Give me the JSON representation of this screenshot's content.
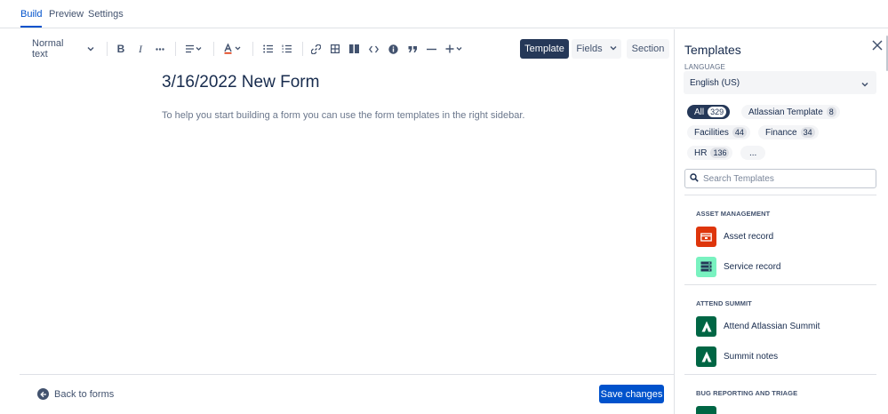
{
  "tabs": [
    {
      "label": "Build",
      "active": true
    },
    {
      "label": "Preview",
      "active": false
    },
    {
      "label": "Settings",
      "active": false
    }
  ],
  "toolbar": {
    "text_style": "Normal text",
    "template": "Template",
    "fields": "Fields",
    "section": "Section",
    "icons": [
      "chevron-down-icon",
      "bold-icon",
      "italic-icon",
      "more-icon",
      "align-icon",
      "text-color-icon",
      "bullet-list-icon",
      "numbered-list-icon",
      "link-icon",
      "table-icon",
      "layout-icon",
      "code-icon",
      "info-icon",
      "quote-icon",
      "divider-icon",
      "plus-icon"
    ]
  },
  "form": {
    "title": "3/16/2022 New Form",
    "hint": "To help you start building a form you can use the form templates in the right sidebar."
  },
  "footer": {
    "back": "Back to forms",
    "save": "Save changes"
  },
  "sidebar": {
    "title": "Templates",
    "language_label": "LANGUAGE",
    "language_value": "English (US)",
    "filters": [
      {
        "label": "All",
        "count": "329",
        "active": true
      },
      {
        "label": "Atlassian Template",
        "count": "8",
        "active": false
      },
      {
        "label": "Facilities",
        "count": "44",
        "active": false
      },
      {
        "label": "Finance",
        "count": "34",
        "active": false
      },
      {
        "label": "HR",
        "count": "136",
        "active": false
      },
      {
        "label": "...",
        "count": "",
        "active": false
      }
    ],
    "search_placeholder": "Search Templates",
    "categories": [
      {
        "title": "ASSET MANAGEMENT",
        "items": [
          {
            "label": "Asset record",
            "icon": "asset-icon",
            "color": "#de350b"
          },
          {
            "label": "Service record",
            "icon": "server-icon",
            "color": "#79f2c0"
          }
        ]
      },
      {
        "title": "ATTEND SUMMIT",
        "items": [
          {
            "label": "Attend Atlassian Summit",
            "icon": "atlassian-logo-icon",
            "color": "#006644"
          },
          {
            "label": "Summit notes",
            "icon": "atlassian-logo-icon",
            "color": "#006644"
          }
        ]
      },
      {
        "title": "BUG REPORTING AND TRIAGE",
        "items": []
      }
    ]
  },
  "colors": {
    "accent": "#0052cc",
    "dark_chip": "#253858",
    "text": "#172b4d",
    "muted": "#6b778c"
  }
}
